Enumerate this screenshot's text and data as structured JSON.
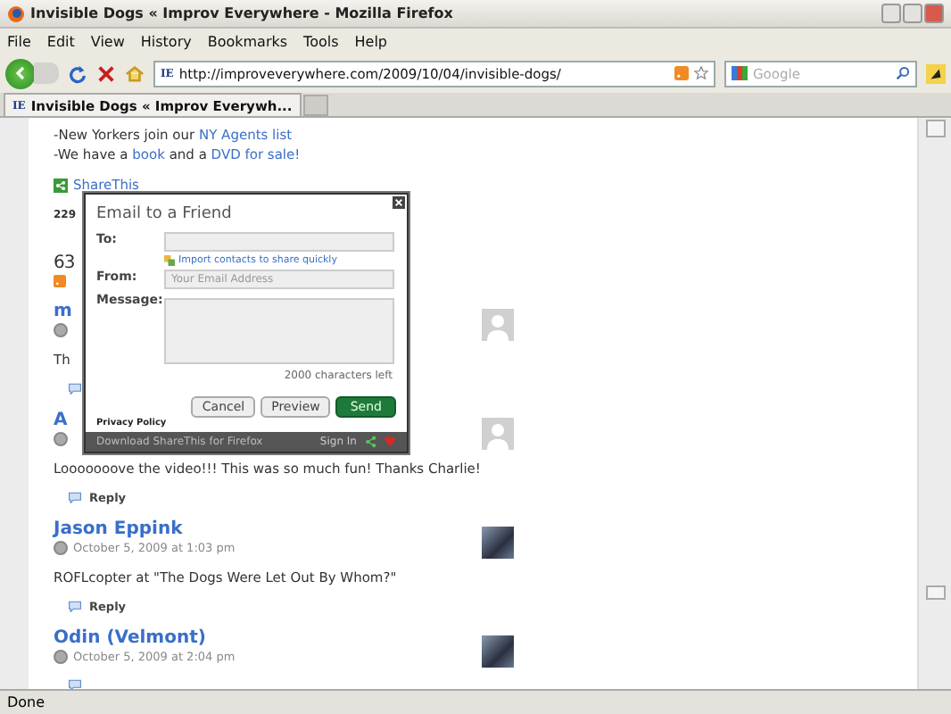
{
  "window": {
    "title": "Invisible Dogs « Improv Everywhere - Mozilla Firefox"
  },
  "menu": [
    "File",
    "Edit",
    "View",
    "History",
    "Bookmarks",
    "Tools",
    "Help"
  ],
  "address": {
    "site_icon": "IE",
    "url": "http://improveverywhere.com/2009/10/04/invisible-dogs/"
  },
  "search": {
    "placeholder": "Google"
  },
  "tabs": [
    {
      "site_icon": "IE",
      "label": "Invisible Dogs « Improv Everywh...",
      "selected": true
    }
  ],
  "page": {
    "links_lines": [
      {
        "before": "-New Yorkers join our ",
        "link": "NY Agents list"
      },
      {
        "before": "-We have a ",
        "link": "book",
        "middle": " and a ",
        "link2": "DVD for sale!"
      }
    ],
    "share": "ShareThis",
    "count": "229",
    "comments_count": "63",
    "comments": [
      {
        "kind": "default",
        "author": "m",
        "text": "Th"
      },
      {
        "kind": "default",
        "author": "A",
        "text": "Looooooove the video!!! This was so much fun! Thanks Charlie!",
        "reply": "Reply"
      },
      {
        "kind": "photo",
        "author": "Jason Eppink",
        "date": "October 5, 2009 at 1:03 pm",
        "text": "ROFLcopter at \"The Dogs Were Let Out By Whom?\"",
        "reply": "Reply"
      },
      {
        "kind": "photo",
        "author": "Odin (Velmont)",
        "date": "October 5, 2009 at 2:04 pm"
      }
    ]
  },
  "dialog": {
    "title": "Email to a Friend",
    "to_label": "To:",
    "import_link": "Import contacts to share quickly",
    "from_label": "From:",
    "from_placeholder": "Your Email Address",
    "message_label": "Message:",
    "chars_left": "2000 characters left",
    "buttons": [
      "Cancel",
      "Preview",
      "Send"
    ],
    "privacy": "Privacy Policy",
    "footer_link": "Download ShareThis for Firefox",
    "sign_in": "Sign In"
  },
  "status_bar": {
    "text": "Done"
  }
}
